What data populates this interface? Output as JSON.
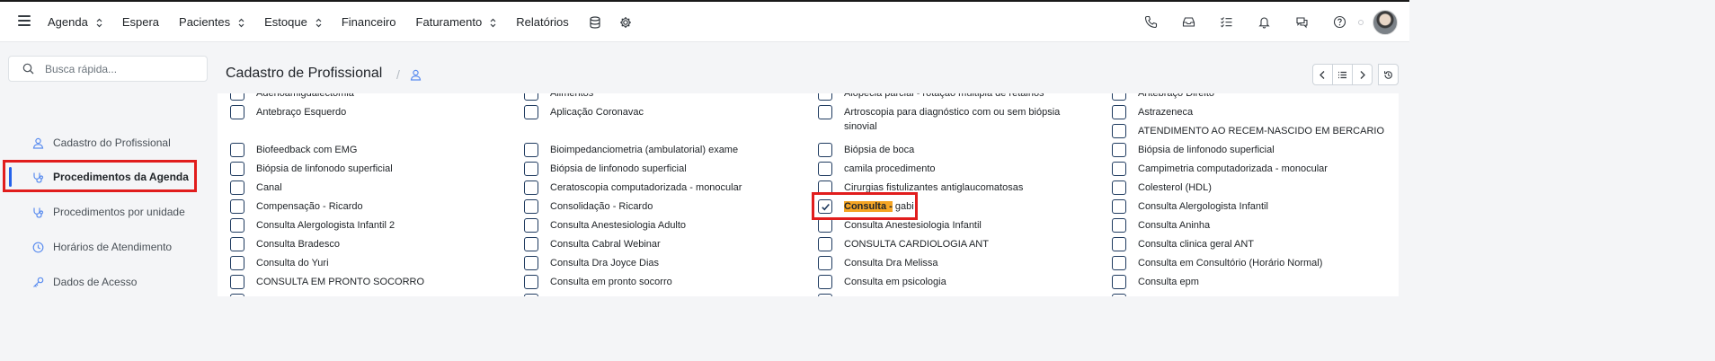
{
  "topnav": {
    "items": [
      {
        "label": "Agenda",
        "dropdown": true
      },
      {
        "label": "Espera",
        "dropdown": false
      },
      {
        "label": "Pacientes",
        "dropdown": true
      },
      {
        "label": "Estoque",
        "dropdown": true
      },
      {
        "label": "Financeiro",
        "dropdown": false
      },
      {
        "label": "Faturamento",
        "dropdown": true
      },
      {
        "label": "Relatórios",
        "dropdown": false
      }
    ],
    "extra_icons": [
      "database-icon",
      "gear-icon"
    ],
    "right_icons": [
      "phone-icon",
      "inbox-icon",
      "checklist-icon",
      "bell-icon",
      "chat-icon",
      "help-icon"
    ]
  },
  "search": {
    "placeholder": "Busca rápida..."
  },
  "sidebar": {
    "items": [
      {
        "label": "Cadastro do Profissional",
        "icon": "user-icon",
        "active": false
      },
      {
        "label": "Procedimentos da Agenda",
        "icon": "stethoscope-icon",
        "active": true
      },
      {
        "label": "Procedimentos por unidade",
        "icon": "stethoscope-icon",
        "active": false
      },
      {
        "label": "Horários de Atendimento",
        "icon": "clock-icon",
        "active": false
      },
      {
        "label": "Dados de Acesso",
        "icon": "key-icon",
        "active": false
      }
    ]
  },
  "page": {
    "title": "Cadastro de Profissional",
    "separator": "/",
    "title_icon": "user-icon"
  },
  "header_buttons": [
    "chevron-left-icon",
    "list-icon",
    "chevron-right-icon",
    "history-icon"
  ],
  "procedures": {
    "columns": [
      [
        {
          "label": "Adenoamigdalectomia",
          "checked": false
        },
        {
          "label": "Antebraço Esquerdo",
          "checked": false
        },
        {
          "label": "Biofeedback com EMG",
          "checked": false
        },
        {
          "label": "Biópsia de linfonodo superficial",
          "checked": false
        },
        {
          "label": "Canal",
          "checked": false
        },
        {
          "label": "Compensação - Ricardo",
          "checked": false
        },
        {
          "label": "Consulta Alergologista Infantil 2",
          "checked": false
        },
        {
          "label": "Consulta Bradesco",
          "checked": false
        },
        {
          "label": "Consulta do Yuri",
          "checked": false
        },
        {
          "label": "CONSULTA EM PRONTO SOCORRO",
          "checked": false
        },
        {
          "label": "",
          "checked": false
        }
      ],
      [
        {
          "label": "Alimentos",
          "checked": false
        },
        {
          "label": "Aplicação Coronavac",
          "checked": false
        },
        {
          "label": "Bioimpedanciometria (ambulatorial) exame",
          "checked": false
        },
        {
          "label": "Biópsia de linfonodo superficial",
          "checked": false
        },
        {
          "label": "Ceratoscopia computadorizada - monocular",
          "checked": false
        },
        {
          "label": "Consolidação - Ricardo",
          "checked": false
        },
        {
          "label": "Consulta Anestesiologia Adulto",
          "checked": false
        },
        {
          "label": "Consulta Cabral Webinar",
          "checked": false
        },
        {
          "label": "Consulta Dra Joyce Dias",
          "checked": false
        },
        {
          "label": "Consulta em pronto socorro",
          "checked": false
        },
        {
          "label": "",
          "checked": false
        }
      ],
      [
        {
          "label": "Alopecia parcial - rotação múltipla de retalhos",
          "checked": false
        },
        {
          "label": "Artroscopia para diagnóstico com ou sem biópsia sinovial",
          "checked": false
        },
        {
          "label": "Biópsia de boca",
          "checked": false
        },
        {
          "label": "camila procedimento",
          "checked": false
        },
        {
          "label": "Cirurgias fistulizantes antiglaucomatosas",
          "checked": false
        },
        {
          "label": "Consulta - gabi",
          "highlight": "Consulta -",
          "rest": " gabi",
          "checked": true
        },
        {
          "label": "Consulta Anestesiologia Infantil",
          "checked": false
        },
        {
          "label": "CONSULTA CARDIOLOGIA ANT",
          "checked": false
        },
        {
          "label": "Consulta Dra Melissa",
          "checked": false
        },
        {
          "label": "Consulta em psicologia",
          "checked": false
        },
        {
          "label": "",
          "checked": false
        }
      ],
      [
        {
          "label": "Antebraço Direito",
          "checked": false
        },
        {
          "label": "Astrazeneca",
          "checked": false
        },
        {
          "label": "ATENDIMENTO AO RECEM-NASCIDO EM BERCARIO",
          "checked": false
        },
        {
          "label": "Biópsia de linfonodo superficial",
          "checked": false
        },
        {
          "label": "Campimetria computadorizada - monocular",
          "checked": false
        },
        {
          "label": "Colesterol (HDL)",
          "checked": false
        },
        {
          "label": "Consulta Alergologista Infantil",
          "checked": false
        },
        {
          "label": "Consulta Aninha",
          "checked": false
        },
        {
          "label": "Consulta clinica geral ANT",
          "checked": false
        },
        {
          "label": "Consulta em Consultório (Horário Normal)",
          "checked": false
        },
        {
          "label": "Consulta epm",
          "checked": false
        },
        {
          "label": "",
          "checked": false
        }
      ]
    ]
  }
}
